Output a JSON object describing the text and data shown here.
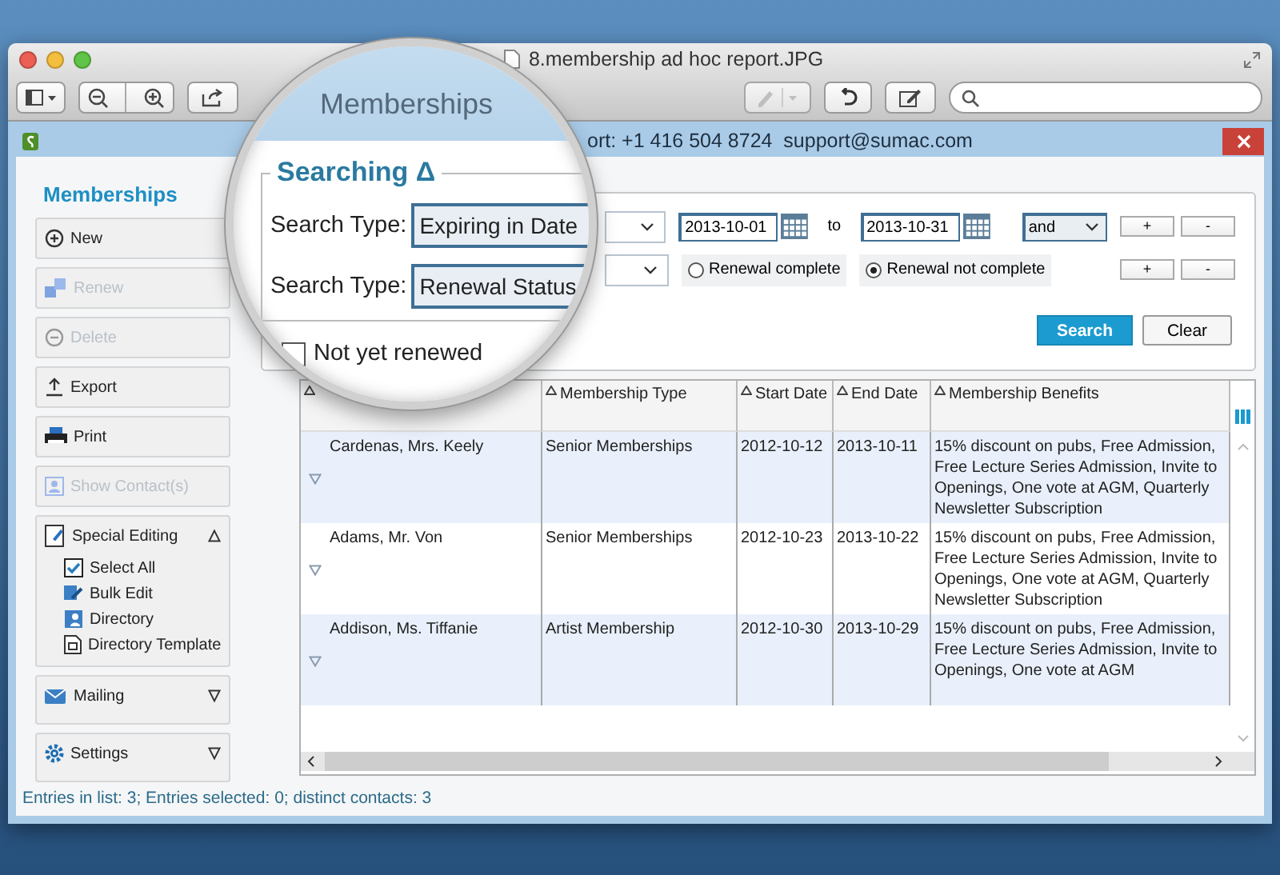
{
  "window": {
    "title": "8.membership ad hoc report.JPG"
  },
  "app": {
    "title_bar": "ort: +1 416 504 8724  support@sumac.com"
  },
  "magnifier": {
    "title": "Memberships",
    "group_title": "Searching Δ",
    "criteria": [
      {
        "label": "Search Type:",
        "value": "Expiring in Date"
      },
      {
        "label": "Search Type:",
        "value": "Renewal Status"
      }
    ],
    "checkbox": {
      "label": "Not yet renewed",
      "checked": false
    }
  },
  "sidebar": {
    "title": "Memberships",
    "items": [
      {
        "kind": "button",
        "label": "New",
        "disabled": false
      },
      {
        "kind": "button",
        "label": "Renew",
        "disabled": true
      },
      {
        "kind": "button",
        "label": "Delete",
        "disabled": true
      },
      {
        "kind": "button",
        "label": "Export",
        "disabled": false
      },
      {
        "kind": "button",
        "label": "Print",
        "disabled": false
      },
      {
        "kind": "button",
        "label": "Show Contact(s)",
        "disabled": true
      },
      {
        "kind": "panel",
        "label": "Special Editing",
        "expanded": true,
        "children": [
          {
            "label": "Select All"
          },
          {
            "label": "Bulk Edit"
          },
          {
            "label": "Directory"
          },
          {
            "label": "Directory Template"
          }
        ]
      },
      {
        "kind": "panel",
        "label": "Mailing",
        "expanded": false
      },
      {
        "kind": "panel",
        "label": "Settings",
        "expanded": false
      }
    ]
  },
  "search": {
    "criteria": [
      {
        "kind": "date_range",
        "from": "2013-10-01",
        "to_label": "to",
        "to": "2013-10-31",
        "conjunction": "and",
        "buttons": [
          "+",
          "-"
        ]
      },
      {
        "kind": "radio",
        "options": [
          {
            "label": "Renewal complete",
            "selected": false
          },
          {
            "label": "Renewal not complete",
            "selected": true
          }
        ],
        "buttons": [
          "+",
          "-"
        ]
      }
    ],
    "search_button": "Search",
    "clear_button": "Clear"
  },
  "table": {
    "columns": [
      "Membership Type",
      "Start Date",
      "End Date",
      "Membership Benefits"
    ],
    "rows": [
      {
        "name": "Cardenas, Mrs. Keely",
        "type": "Senior Memberships",
        "start": "2012-10-12",
        "end": "2013-10-11",
        "benefits": "15% discount on pubs, Free Admission, Free Lecture Series Admission, Invite to Openings, One vote at AGM, Quarterly Newsletter Subscription"
      },
      {
        "name": "Adams, Mr. Von",
        "type": "Senior Memberships",
        "start": "2012-10-23",
        "end": "2013-10-22",
        "benefits": "15% discount on pubs, Free Admission, Free Lecture Series Admission, Invite to Openings, One vote at AGM, Quarterly Newsletter Subscription"
      },
      {
        "name": "Addison, Ms. Tiffanie",
        "type": "Artist Membership",
        "start": "2012-10-30",
        "end": "2013-10-29",
        "benefits": "15% discount on pubs, Free Admission, Free Lecture Series Admission, Invite to Openings, One vote at AGM"
      }
    ]
  },
  "status_bar": "Entries in list: 3; Entries selected: 0; distinct contacts: 3"
}
